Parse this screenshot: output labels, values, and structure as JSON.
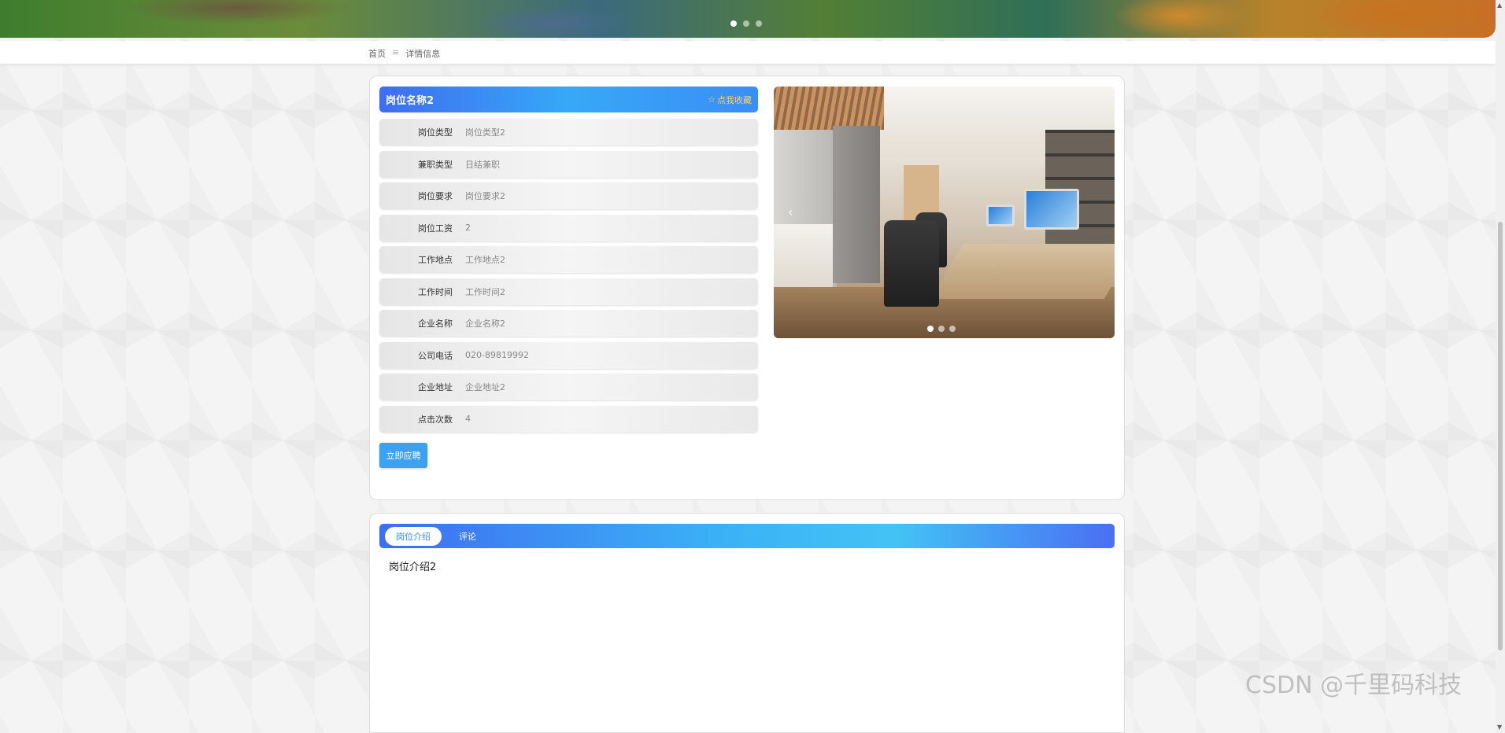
{
  "banner": {
    "dots": 3,
    "active_dot": 0
  },
  "breadcrumb": {
    "home": "首页",
    "separator": "≡",
    "current": "详情信息"
  },
  "job": {
    "title": "岗位名称2",
    "favorite_label": "点我收藏",
    "fields": [
      {
        "label": "岗位类型",
        "value": "岗位类型2"
      },
      {
        "label": "兼职类型",
        "value": "日结兼职"
      },
      {
        "label": "岗位要求",
        "value": "岗位要求2"
      },
      {
        "label": "岗位工资",
        "value": "2"
      },
      {
        "label": "工作地点",
        "value": "工作地点2"
      },
      {
        "label": "工作时间",
        "value": "工作时间2"
      },
      {
        "label": "企业名称",
        "value": "企业名称2"
      },
      {
        "label": "公司电话",
        "value": "020-89819992"
      },
      {
        "label": "企业地址",
        "value": "企业地址2"
      },
      {
        "label": "点击次数",
        "value": "4"
      }
    ],
    "apply_label": "立即应聘"
  },
  "carousel": {
    "prev_icon": "chevron-left-icon",
    "dots": 3,
    "active_dot": 0
  },
  "tabs": [
    {
      "label": "岗位介绍",
      "active": true
    },
    {
      "label": "评论",
      "active": false
    }
  ],
  "tab_content": "岗位介绍2",
  "watermark": "CSDN @千里码科技",
  "colors": {
    "accent": "#3a8ef5",
    "gradient_start": "#3f6df0",
    "gradient_mid": "#37a8f7",
    "favorite": "#ffd45c",
    "apply_button": "#3ea0f0"
  }
}
